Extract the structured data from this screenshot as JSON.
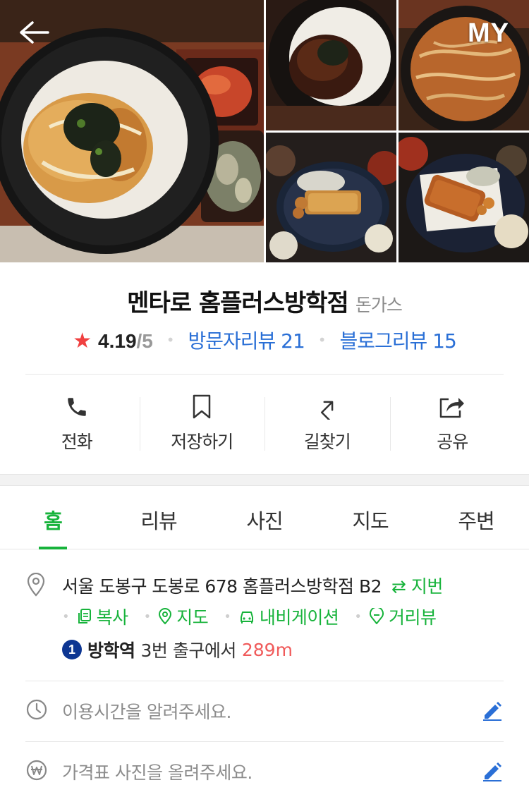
{
  "header": {
    "back_icon": "arrow-left-icon",
    "my_label": "MY"
  },
  "place": {
    "name": "멘타로 홈플러스방학점",
    "category": "돈가스",
    "rating": "4.19",
    "rating_max": "/5",
    "visitor_reviews": "방문자리뷰 21",
    "blog_reviews": "블로그리뷰 15"
  },
  "actions": [
    {
      "icon": "phone-icon",
      "label": "전화"
    },
    {
      "icon": "bookmark-icon",
      "label": "저장하기"
    },
    {
      "icon": "directions-icon",
      "label": "길찾기"
    },
    {
      "icon": "share-icon",
      "label": "공유"
    }
  ],
  "tabs": [
    {
      "label": "홈",
      "active": true
    },
    {
      "label": "리뷰",
      "active": false
    },
    {
      "label": "사진",
      "active": false
    },
    {
      "label": "지도",
      "active": false
    },
    {
      "label": "주변",
      "active": false
    }
  ],
  "address": {
    "text": "서울 도봉구 도봉로 678 홈플러스방학점 B2",
    "jibun": "⇄ 지번",
    "links": [
      "복사",
      "지도",
      "내비게이션",
      "거리뷰"
    ],
    "subway_line": "1",
    "station": "방학역",
    "exit": "3번 출구에서",
    "distance": "289m"
  },
  "info": {
    "hours_prompt": "이용시간을 알려주세요.",
    "price_prompt": "가격표 사진을 올려주세요."
  },
  "colors": {
    "accent_green": "#17b33b",
    "link_blue": "#2a6fd6",
    "star_red": "#f04040",
    "distance_red": "#f05a5a",
    "line1_blue": "#0d3692"
  }
}
